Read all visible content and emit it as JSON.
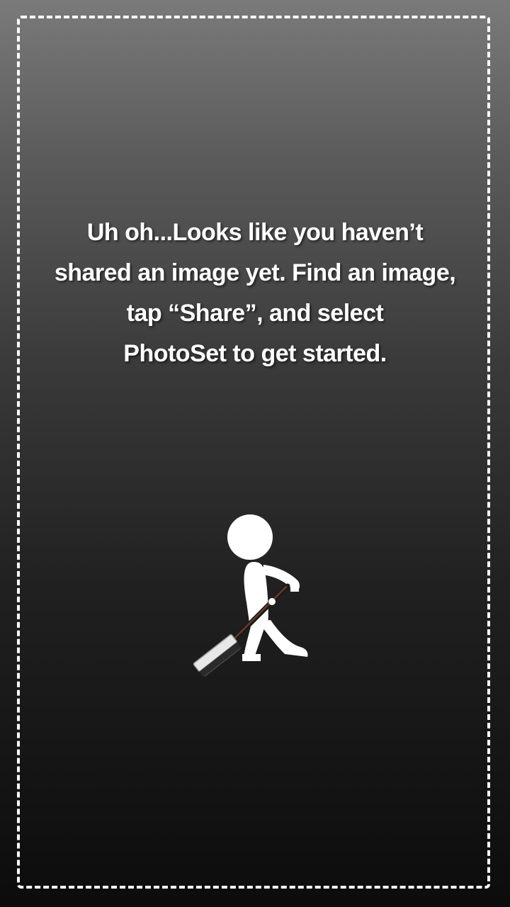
{
  "empty_state": {
    "message_lines": [
      "Uh oh...Looks like you haven’t",
      "shared an image yet.  Find an image,",
      "tap “Share”, and select",
      "PhotoSet to get started."
    ],
    "illustration_icon": "stick-figure-sweeping-icon"
  },
  "colors": {
    "text": "#ffffff",
    "frame_border": "#ffffff",
    "background_top": "#7a7a7a",
    "background_bottom": "#0c0c0c"
  }
}
